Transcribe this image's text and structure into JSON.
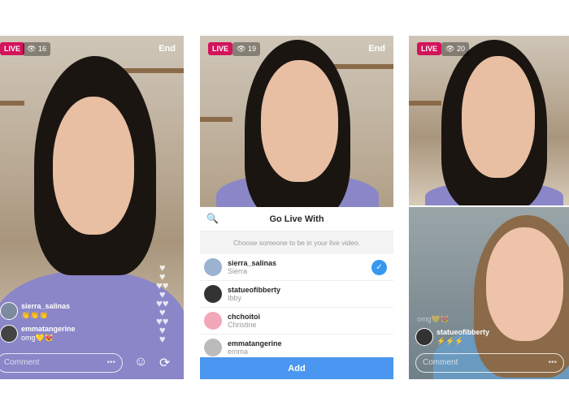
{
  "panels": [
    {
      "live": "LIVE",
      "viewers": "16",
      "end": "End",
      "comments": [
        {
          "user": "sierra_salinas",
          "msg": "👏👏👏"
        },
        {
          "user": "emmatangerine",
          "msg": "omg💛😻"
        }
      ],
      "comment_placeholder": "Comment",
      "more": "•••"
    },
    {
      "live": "LIVE",
      "viewers": "19",
      "end": "End",
      "sheet": {
        "title": "Go Live With",
        "subtitle": "Choose someone to be in your live video.",
        "users": [
          {
            "username": "sierra_salinas",
            "name": "Sierra",
            "selected": true
          },
          {
            "username": "statueofibberty",
            "name": "Ibby",
            "selected": false
          },
          {
            "username": "chchoitoi",
            "name": "Christine",
            "selected": false
          },
          {
            "username": "emmatangerine",
            "name": "emma",
            "selected": false
          }
        ],
        "add_label": "Add"
      }
    },
    {
      "live": "LIVE",
      "viewers": "20",
      "comments": [
        {
          "user": "",
          "msg": "omg💛😻"
        },
        {
          "user": "statueofibberty",
          "msg": "⚡⚡⚡"
        }
      ],
      "comment_placeholder": "Comment",
      "more": "•••"
    }
  ],
  "colors": {
    "live": "#d3135c",
    "accent": "#3897f0",
    "add_button": "#4a96f0"
  }
}
